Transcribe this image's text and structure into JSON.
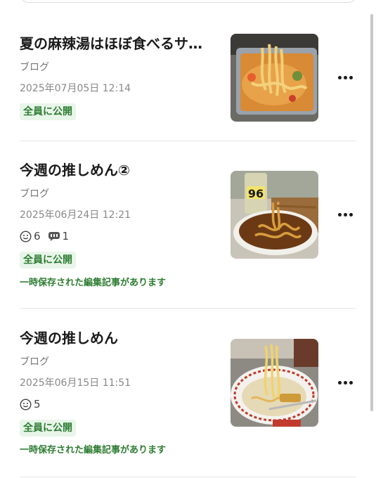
{
  "articles": [
    {
      "title": "夏の麻辣湯はほぼ食べるサ…",
      "category": "ブログ",
      "date": "2025年07月05日 12:14",
      "visibility": "全員に公開",
      "thumbnail": "noodle-soup-tray-photo",
      "more_icon": "more-horizontal-icon"
    },
    {
      "title": "今週の推しめん②",
      "category": "ブログ",
      "date": "2025年06月24日 12:21",
      "likes": "6",
      "comments": "1",
      "visibility": "全員に公開",
      "draft_note": "一時保存された編集記事があります",
      "thumbnail": "cup-noodle-with-drink-photo",
      "more_icon": "more-horizontal-icon"
    },
    {
      "title": "今週の推しめん",
      "category": "ブログ",
      "date": "2025年06月15日 11:51",
      "likes": "5",
      "visibility": "全員に公開",
      "draft_note": "一時保存された編集記事があります",
      "thumbnail": "ramen-bowl-photo",
      "more_icon": "more-horizontal-icon"
    }
  ],
  "icons": {
    "like": "smile-icon",
    "comment": "comment-icon"
  },
  "colors": {
    "badge_bg": "#e8f5e9",
    "badge_text": "#2e7d32",
    "meta_text": "#888888"
  }
}
